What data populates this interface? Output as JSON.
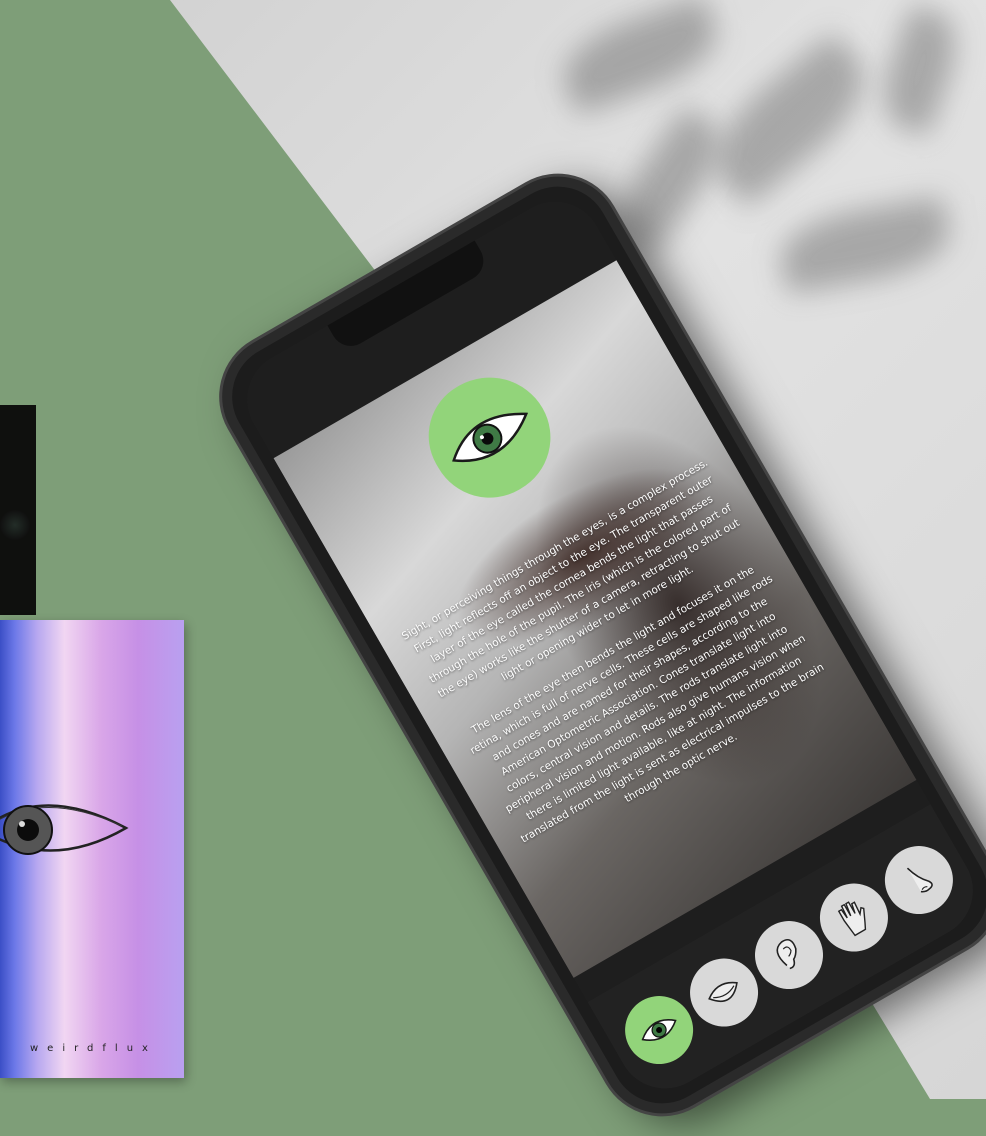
{
  "poster": {
    "brand": "weirdflux"
  },
  "article": {
    "paragraphs": [
      "Sight, or perceiving things through the eyes, is a complex process. First, light reflects off an object to the eye. The transparent outer layer of the eye called the cornea bends the light that passes through the hole of the pupil. The iris (which is the colored part of the eye) works like the shutter of a camera, retracting to shut out light or opening wider to let in more light.",
      "The lens of the eye then bends the light and focuses it on the retina, which is full of nerve cells. These cells are shaped like rods and cones and are named for their shapes, according to the American Optometric Association. Cones translate light into colors, central vision and details. The rods translate light into peripheral vision and motion. Rods also give humans vision when there is limited light available, like at night. The information translated from the light is sent as electrical impulses to the brain through the optic nerve."
    ]
  },
  "tabs": [
    {
      "icon": "eye-icon",
      "active": true
    },
    {
      "icon": "mouth-icon",
      "active": false
    },
    {
      "icon": "ear-icon",
      "active": false
    },
    {
      "icon": "hand-icon",
      "active": false
    },
    {
      "icon": "nose-icon",
      "active": false
    }
  ],
  "colors": {
    "accent": "#92d47a",
    "tabbar": "#222222",
    "background_green": "#7e9e78"
  }
}
